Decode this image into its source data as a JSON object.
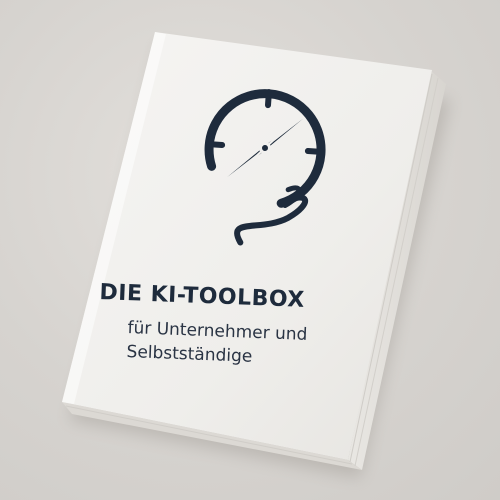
{
  "book": {
    "title": "DIE KI-TOOLBOX",
    "subtitle_line1": "für Unternehmer und",
    "subtitle_line2": "Selbstständige"
  },
  "colors": {
    "background": "#d9d6d2",
    "cover": "#f1f0ee",
    "ink": "#1e2b3c"
  },
  "icon": "compass-icon"
}
